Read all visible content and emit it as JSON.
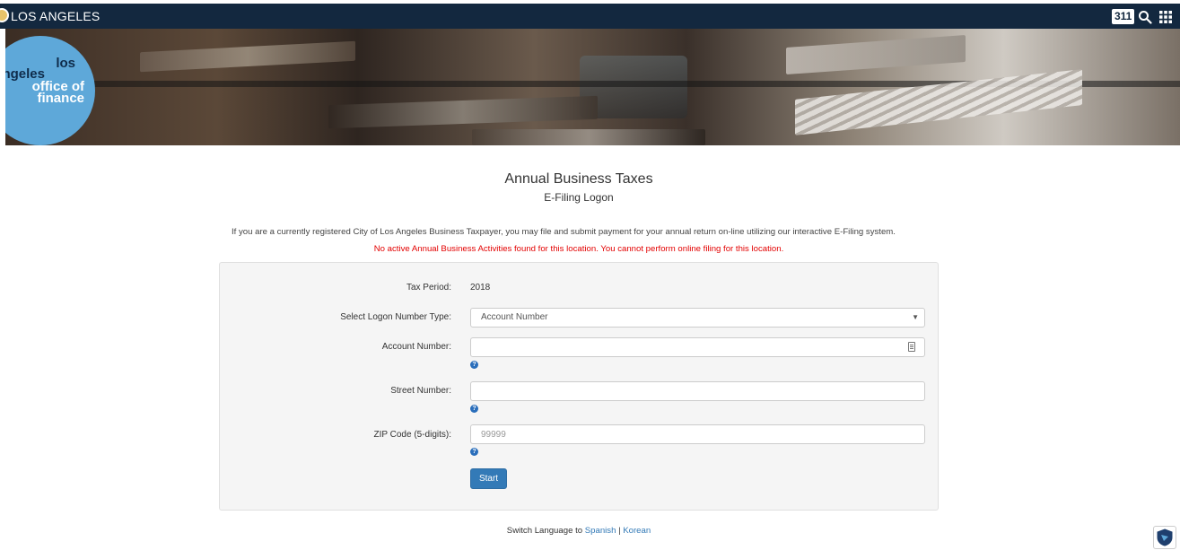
{
  "topbar": {
    "site_name": "LOS ANGELES",
    "badge_311": "311",
    "icons": [
      "city-seal-icon",
      "search-icon",
      "apps-grid-icon"
    ]
  },
  "banner": {
    "logo_lines": [
      "los",
      "ngeles",
      "office of",
      "finance"
    ]
  },
  "header": {
    "title": "Annual Business Taxes",
    "subtitle": "E-Filing Logon"
  },
  "intro_text": "If you are a currently registered City of Los Angeles Business Taxpayer, you may file and submit payment for your annual return on-line utilizing our interactive E-Filing system.",
  "error_text": "No active Annual Business Activities found for this location. You cannot perform online filing for this location.",
  "form": {
    "tax_period_label": "Tax Period:",
    "tax_period_value": "2018",
    "logon_type_label": "Select Logon Number Type:",
    "logon_type_value": "Account Number",
    "account_number_label": "Account Number:",
    "account_number_value": "",
    "street_number_label": "Street Number:",
    "street_number_value": "",
    "zip_label": "ZIP Code (5-digits):",
    "zip_placeholder": "99999",
    "start_label": "Start"
  },
  "footer": {
    "switch_text": "Switch Language to ",
    "spanish": "Spanish",
    "separator": " | ",
    "korean": "Korean"
  },
  "colors": {
    "topbar": "#13283f",
    "logo_blue": "#5ea8d9",
    "error_red": "#e30000",
    "primary": "#337ab7"
  }
}
